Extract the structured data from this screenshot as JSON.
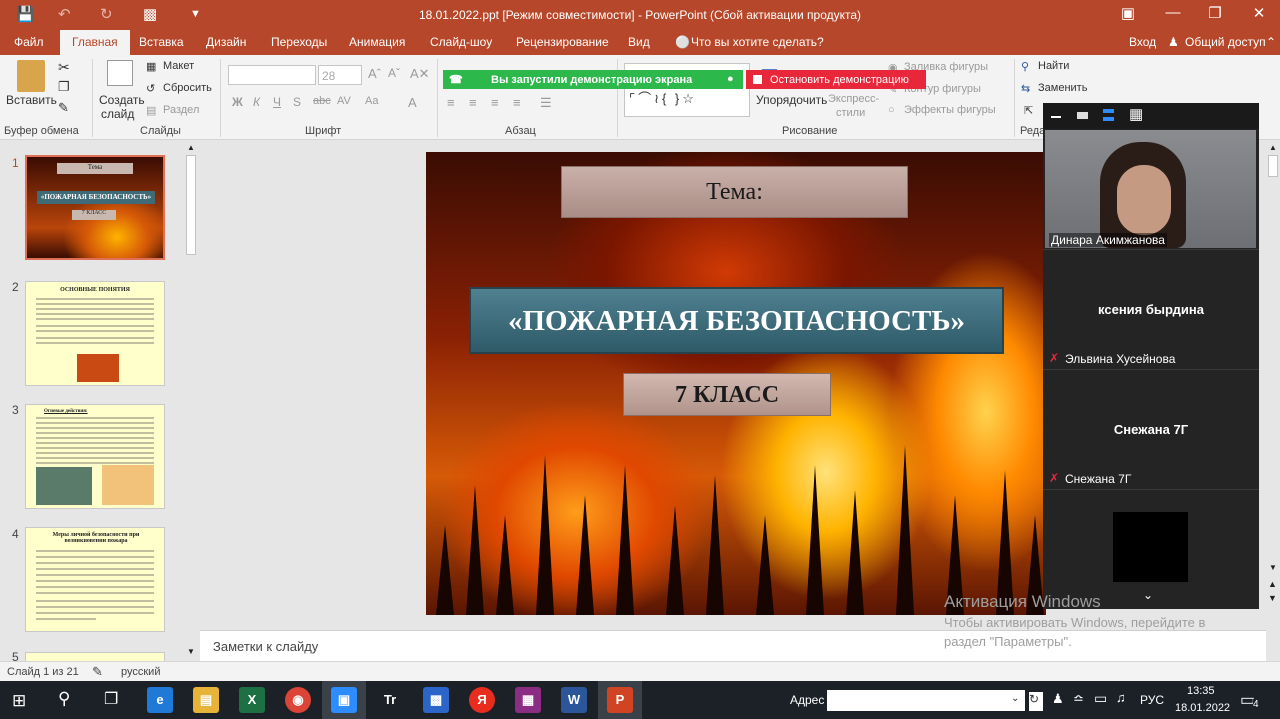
{
  "window": {
    "title": "18.01.2022.ppt [Режим совместимости] - PowerPoint (Сбой активации продукта)"
  },
  "tabs": [
    "Файл",
    "Главная",
    "Вставка",
    "Дизайн",
    "Переходы",
    "Анимация",
    "Слайд-шоу",
    "Рецензирование",
    "Вид"
  ],
  "tell_me": "Что вы хотите сделать?",
  "account": {
    "signin": "Вход",
    "share": "Общий доступ"
  },
  "ribbon": {
    "paste": "Вставить",
    "clipboard_group": "Буфер обмена",
    "new_slide": "Создать",
    "new_slide_2": "слайд",
    "layout": "Макет",
    "reset": "Сбросить",
    "section": "Раздел",
    "slides_group": "Слайды",
    "font_size": "28",
    "font_group": "Шрифт",
    "para_group": "Абзац",
    "arrange": "Упорядочить",
    "quick_styles": "Экспресс-",
    "quick_styles_2": "стили",
    "shape_fill": "Заливка фигуры",
    "shape_outline": "Контур фигуры",
    "shape_effects": "Эффекты фигуры",
    "drawing_group": "Рисование",
    "find": "Найти",
    "replace": "Заменить",
    "edit_group": "Реда"
  },
  "share_bar": {
    "status": "Вы запустили демонстрацию экрана",
    "stop": "Остановить демонстрацию"
  },
  "thumbnails": [
    {
      "num": "1",
      "title": "«ПОЖАРНАЯ БЕЗОПАСНОСТЬ»",
      "label_top": "Тема",
      "label_bottom": "7 КЛАСС"
    },
    {
      "num": "2",
      "title": "ОСНОВНЫЕ ПОНЯТИЯ"
    },
    {
      "num": "3",
      "title": "Огневые действия:"
    },
    {
      "num": "4",
      "title": "Меры личной безопасности при возникновении пожара"
    },
    {
      "num": "5"
    }
  ],
  "slide": {
    "theme_label": "Тема:",
    "title": "«ПОЖАРНАЯ БЕЗОПАСНОСТЬ»",
    "class": "7 КЛАСС"
  },
  "notes": "Заметки к слайду",
  "status": {
    "slide_info": "Слайд 1 из 21",
    "language": "русский"
  },
  "zoom": {
    "participants": [
      {
        "name": "Динара Акимжанова"
      },
      {
        "display": "ксения бырдина",
        "name": "Эльвина Хусейнова"
      },
      {
        "display": "Снежана 7Г",
        "name": "Снежана 7Г"
      }
    ]
  },
  "watermark": {
    "title": "Активация Windows",
    "line1": "Чтобы активировать Windows, перейдите в",
    "line2": "раздел \"Параметры\"."
  },
  "taskbar": {
    "address_label": "Адрес",
    "language": "РУС",
    "time": "13:35",
    "date": "18.01.2022",
    "notif_count": "4"
  },
  "colors": {
    "accent": "#b7472a",
    "share_green": "#2db84c",
    "share_red": "#e8273a"
  }
}
